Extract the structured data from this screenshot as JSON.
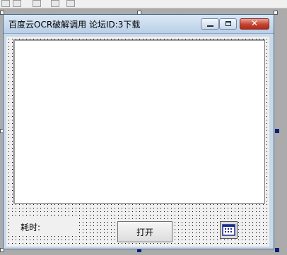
{
  "window": {
    "title": "百度云OCR破解调用 论坛ID:3下载",
    "close_glyph": "✕"
  },
  "form": {
    "time_label": "耗时:",
    "open_button": "打开"
  },
  "icons": {
    "timer": "timer-control-icon",
    "minimize": "minimize-icon",
    "maximize": "maximize-icon",
    "close": "close-icon"
  },
  "colors": {
    "designer_background": "#ababab",
    "client_background": "#f0f0f0",
    "close_button": "#c5432f",
    "handle_solid": "#0a1f7a"
  }
}
